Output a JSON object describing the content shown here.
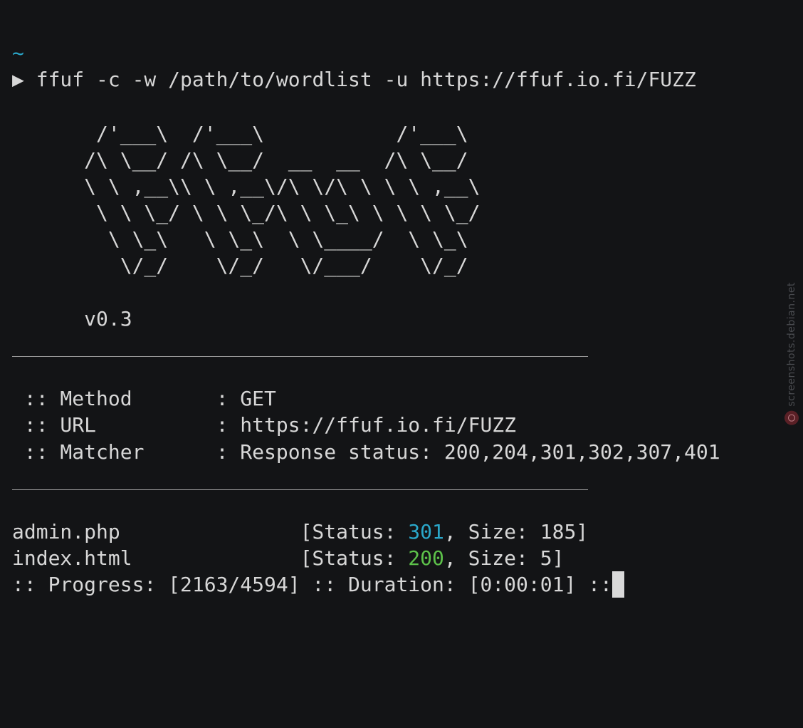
{
  "terminal": {
    "cwd": "~",
    "prompt_symbol": "▶",
    "command": "ffuf -c -w /path/to/wordlist -u https://ffuf.io.fi/FUZZ",
    "banner": [
      "       /'___\\  /'___\\           /'___\\",
      "      /\\ \\__/ /\\ \\__/  __  __  /\\ \\__/",
      "      \\ \\ ,__\\\\ \\ ,__\\/\\ \\/\\ \\ \\ \\ ,__\\",
      "       \\ \\ \\_/ \\ \\ \\_/\\ \\ \\_\\ \\ \\ \\ \\_/",
      "        \\ \\_\\   \\ \\_\\  \\ \\____/  \\ \\_\\",
      "         \\/_/    \\/_/   \\/___/    \\/_/"
    ],
    "version": "      v0.3",
    "config": [
      {
        "label": " :: Method       : ",
        "value": "GET"
      },
      {
        "label": " :: URL          : ",
        "value": "https://ffuf.io.fi/FUZZ"
      },
      {
        "label": " :: Matcher      : ",
        "value": "Response status: 200,204,301,302,307,401"
      }
    ],
    "results": [
      {
        "name": "admin.php               ",
        "status_prefix": "[Status: ",
        "status": "301",
        "size_text": ", Size: 185]",
        "status_color": "#2aa7c9"
      },
      {
        "name": "index.html              ",
        "status_prefix": "[Status: ",
        "status": "200",
        "size_text": ", Size: 5]",
        "status_color": "#5dc24a"
      }
    ],
    "progress_line": ":: Progress: [2163/4594] :: Duration: [0:00:01] ::"
  },
  "watermark": {
    "text": "screenshots.debian.net",
    "icon": "debian-swirl-icon"
  },
  "colors": {
    "background": "#131416",
    "foreground": "#d7d7d7",
    "cyan": "#2aa7c9",
    "green": "#5dc24a"
  }
}
